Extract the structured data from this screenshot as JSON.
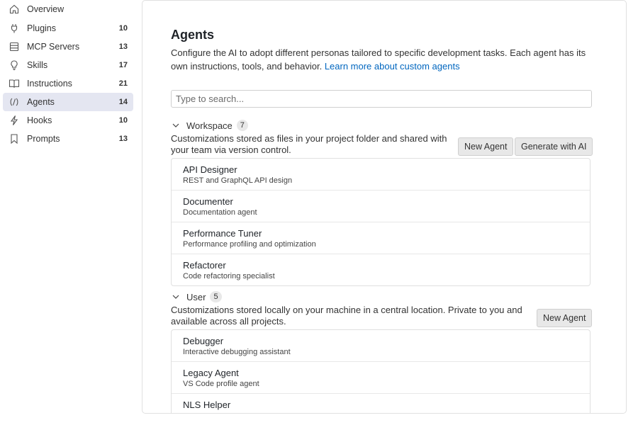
{
  "sidebar": {
    "items": [
      {
        "label": "Overview",
        "count": "",
        "icon": "home-icon"
      },
      {
        "label": "Plugins",
        "count": "10",
        "icon": "plug-icon"
      },
      {
        "label": "MCP Servers",
        "count": "13",
        "icon": "server-icon"
      },
      {
        "label": "Skills",
        "count": "17",
        "icon": "lightbulb-icon"
      },
      {
        "label": "Instructions",
        "count": "21",
        "icon": "book-icon"
      },
      {
        "label": "Agents",
        "count": "14",
        "icon": "agent-icon"
      },
      {
        "label": "Hooks",
        "count": "10",
        "icon": "lightning-icon"
      },
      {
        "label": "Prompts",
        "count": "13",
        "icon": "bookmark-icon"
      }
    ],
    "active": "Agents"
  },
  "main": {
    "title": "Agents",
    "description": "Configure the AI to adopt different personas tailored to specific development tasks. Each agent has its own instructions, tools, and behavior.",
    "learn_more": "Learn more about custom agents",
    "search_placeholder": "Type to search...",
    "sections": [
      {
        "name": "Workspace",
        "count": "7",
        "description": "Customizations stored as files in your project folder and shared with your team via version control.",
        "buttons": [
          "New Agent",
          "Generate with AI"
        ],
        "items": [
          {
            "name": "API Designer",
            "desc": "REST and GraphQL API design"
          },
          {
            "name": "Documenter",
            "desc": "Documentation agent"
          },
          {
            "name": "Performance Tuner",
            "desc": "Performance profiling and optimization"
          },
          {
            "name": "Refactorer",
            "desc": "Code refactoring specialist"
          }
        ]
      },
      {
        "name": "User",
        "count": "5",
        "description": "Customizations stored locally on your machine in a central location. Private to you and available across all projects.",
        "buttons": [
          "New Agent"
        ],
        "items": [
          {
            "name": "Debugger",
            "desc": "Interactive debugging assistant"
          },
          {
            "name": "Legacy Agent",
            "desc": "VS Code profile agent"
          },
          {
            "name": "NLS Helper",
            "desc": ""
          }
        ]
      }
    ]
  },
  "colors": {
    "active_bg": "#e4e6f1",
    "link": "#0066bf",
    "button_bg": "#e8e8e8"
  }
}
